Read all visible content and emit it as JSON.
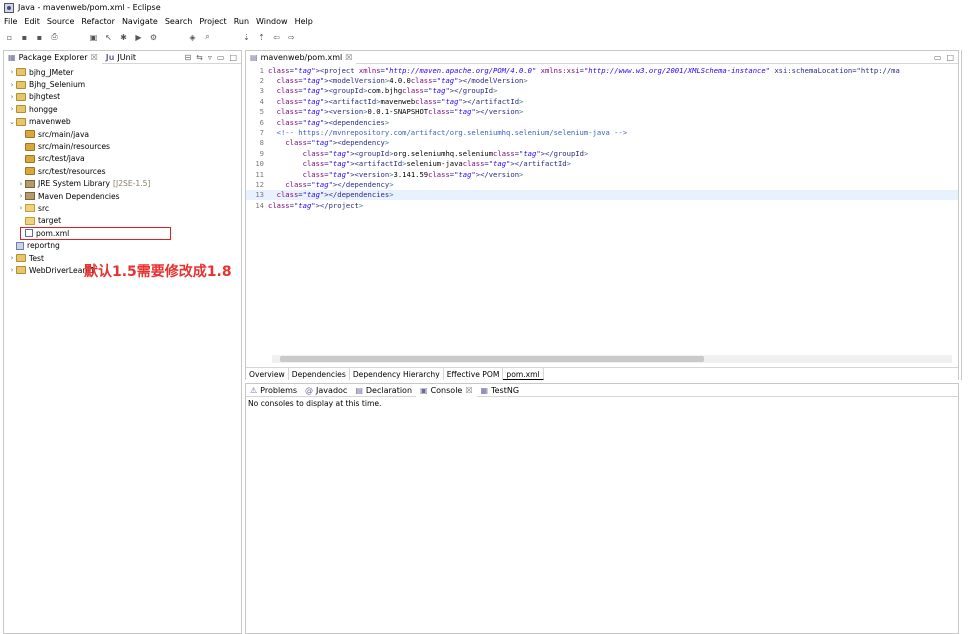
{
  "window": {
    "title": "Java - mavenweb/pom.xml - Eclipse"
  },
  "menu": [
    "File",
    "Edit",
    "Source",
    "Refactor",
    "Navigate",
    "Search",
    "Project",
    "Run",
    "Window",
    "Help"
  ],
  "toolbar": {
    "icons": [
      "new-icon",
      "save-icon",
      "save-all-icon",
      "print-icon",
      "terminal-icon",
      "cursor-icon",
      "debug-icon",
      "run-icon",
      "external-tools-icon",
      "open-type-icon",
      "search-icon",
      "next-annotation-icon",
      "prev-annotation-icon",
      "back-icon",
      "forward-icon"
    ]
  },
  "explorer": {
    "tabs": [
      {
        "label": "Package Explorer",
        "suffix": "☒"
      },
      {
        "label": "JUnit"
      }
    ],
    "tree": [
      {
        "label": "bjhg_JMeter",
        "arrow": "›",
        "icon": "proj",
        "depth": 0
      },
      {
        "label": "Bjhg_Selenium",
        "arrow": "›",
        "icon": "proj",
        "depth": 0
      },
      {
        "label": "bjhgtest",
        "arrow": "›",
        "icon": "proj",
        "depth": 0
      },
      {
        "label": "hongge",
        "arrow": "›",
        "icon": "proj",
        "depth": 0
      },
      {
        "label": "mavenweb",
        "arrow": "⌄",
        "icon": "proj",
        "depth": 0
      },
      {
        "label": "src/main/java",
        "arrow": "",
        "icon": "pkg",
        "depth": 1
      },
      {
        "label": "src/main/resources",
        "arrow": "",
        "icon": "pkg",
        "depth": 1
      },
      {
        "label": "src/test/java",
        "arrow": "",
        "icon": "pkg",
        "depth": 1
      },
      {
        "label": "src/test/resources",
        "arrow": "",
        "icon": "pkg",
        "depth": 1
      },
      {
        "label": "JRE System Library",
        "suffix": "[J2SE-1.5]",
        "arrow": "›",
        "icon": "lib",
        "depth": 1
      },
      {
        "label": "Maven Dependencies",
        "arrow": "›",
        "icon": "lib",
        "depth": 1
      },
      {
        "label": "src",
        "arrow": "›",
        "icon": "folder",
        "depth": 1
      },
      {
        "label": "target",
        "arrow": "",
        "icon": "folder",
        "depth": 1
      },
      {
        "label": "pom.xml",
        "arrow": "",
        "icon": "xml",
        "depth": 1
      },
      {
        "label": "reportng",
        "arrow": "",
        "icon": "generic",
        "depth": 0
      },
      {
        "label": "Test",
        "arrow": "›",
        "icon": "proj",
        "depth": 0
      },
      {
        "label": "WebDriverLearn1",
        "arrow": "›",
        "icon": "proj",
        "depth": 0
      }
    ],
    "annotation": "默认1.5需要修改成1.8"
  },
  "editor": {
    "tab": {
      "label": "mavenweb/pom.xml",
      "suffix": "☒"
    },
    "lines": [
      {
        "n": "1",
        "text": "<project xmlns=\"http://maven.apache.org/POM/4.0.0\" xmlns:xsi=\"http://www.w3.org/2001/XMLSchema-instance\" xsi:schemaLocation=\"http://ma"
      },
      {
        "n": "2",
        "text": "  <modelVersion>4.0.0</modelVersion>"
      },
      {
        "n": "3",
        "text": "  <groupId>com.bjhg</groupId>"
      },
      {
        "n": "4",
        "text": "  <artifactId>mavenweb</artifactId>"
      },
      {
        "n": "5",
        "text": "  <version>0.0.1-SNAPSHOT</version>"
      },
      {
        "n": "6",
        "text": "  <dependencies>"
      },
      {
        "n": "7",
        "text": "  <!-- https://mvnrepository.com/artifact/org.seleniumhq.selenium/selenium-java -->"
      },
      {
        "n": "8",
        "text": "    <dependency>"
      },
      {
        "n": "9",
        "text": "        <groupId>org.seleniumhq.selenium</groupId>"
      },
      {
        "n": "10",
        "text": "        <artifactId>selenium-java</artifactId>"
      },
      {
        "n": "11",
        "text": "        <version>3.141.59</version>"
      },
      {
        "n": "12",
        "text": "    </dependency>"
      },
      {
        "n": "13",
        "text": "  </dependencies>"
      },
      {
        "n": "14",
        "text": "</project>"
      }
    ],
    "pom_tabs": [
      "Overview",
      "Dependencies",
      "Dependency Hierarchy",
      "Effective POM",
      "pom.xml"
    ]
  },
  "console": {
    "tabs": [
      {
        "label": "Problems"
      },
      {
        "label": "Javadoc"
      },
      {
        "label": "Declaration"
      },
      {
        "label": "Console",
        "suffix": "☒"
      },
      {
        "label": "TestNG"
      }
    ],
    "message": "No consoles to display at this time."
  },
  "colors": {
    "annotation_red": "#e8322f",
    "highlight_line": "#e8f2fe"
  }
}
